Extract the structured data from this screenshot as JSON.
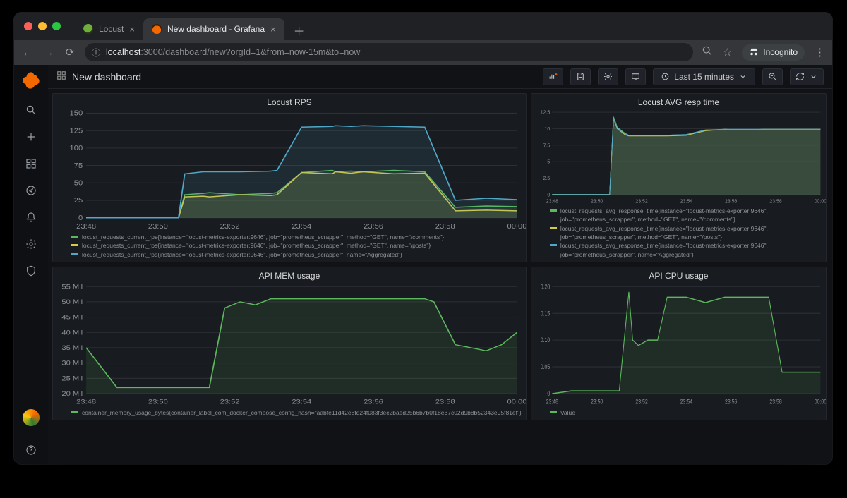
{
  "browser": {
    "tabs": [
      {
        "label": "Locust",
        "active": false
      },
      {
        "label": "New dashboard - Grafana",
        "active": true
      }
    ],
    "url_host": "localhost",
    "url_rest": ":3000/dashboard/new?orgId=1&from=now-15m&to=now",
    "incognito_label": "Incognito"
  },
  "grafana": {
    "title": "New dashboard",
    "toolbar": {
      "time_label": "Last 15 minutes"
    },
    "sidebar": {
      "items": [
        {
          "name": "search",
          "icon": "search"
        },
        {
          "name": "create",
          "icon": "plus"
        },
        {
          "name": "dashboards",
          "icon": "grid"
        },
        {
          "name": "explore",
          "icon": "compass"
        },
        {
          "name": "alerting",
          "icon": "bell"
        },
        {
          "name": "configuration",
          "icon": "gear"
        },
        {
          "name": "server-admin",
          "icon": "shield"
        }
      ]
    }
  },
  "chart_data": [
    {
      "id": "rps",
      "type": "area",
      "title": "Locust RPS",
      "xlabel": "",
      "ylabel": "",
      "x_ticks": [
        "23:48",
        "23:50",
        "23:52",
        "23:54",
        "23:56",
        "23:58",
        "00:00"
      ],
      "ylim": [
        0,
        150
      ],
      "y_ticks": [
        0,
        25,
        50,
        75,
        100,
        125,
        150
      ],
      "x": [
        0,
        1,
        2,
        3,
        3.2,
        3.8,
        4,
        5,
        6,
        6.2,
        7,
        8,
        8.1,
        8.6,
        9,
        10,
        11,
        12,
        13,
        14
      ],
      "series": [
        {
          "name": "locust_requests_current_rps{instance=\"locust-metrics-exporter:9646\", job=\"prometheus_scrapper\", method=\"GET\", name=\"/comments\"}",
          "color": "#5cb85c",
          "values": [
            0,
            0,
            0,
            0,
            33,
            35,
            36,
            33,
            35,
            36,
            65,
            68,
            66,
            67,
            66,
            68,
            66,
            15,
            17,
            16
          ]
        },
        {
          "name": "locust_requests_current_rps{instance=\"locust-metrics-exporter:9646\", job=\"prometheus_scrapper\", method=\"GET\", name=\"/posts\"}",
          "color": "#d4c94a",
          "values": [
            0,
            0,
            0,
            0,
            30,
            31,
            30,
            33,
            32,
            33,
            65,
            63,
            66,
            64,
            66,
            63,
            64,
            10,
            11,
            10
          ]
        },
        {
          "name": "locust_requests_current_rps{instance=\"locust-metrics-exporter:9646\", job=\"prometheus_scrapper\", name=\"Aggregated\"}",
          "color": "#4fa8c8",
          "values": [
            0,
            0,
            0,
            0,
            63,
            66,
            66,
            66,
            67,
            68,
            130,
            131,
            132,
            131,
            132,
            131,
            130,
            25,
            28,
            26
          ]
        }
      ]
    },
    {
      "id": "resp",
      "type": "area",
      "title": "Locust AVG resp time",
      "xlabel": "",
      "ylabel": "",
      "x_ticks": [
        "23:48",
        "23:50",
        "23:52",
        "23:54",
        "23:56",
        "23:58",
        "00:00"
      ],
      "ylim": [
        0,
        12.5
      ],
      "y_ticks": [
        0,
        2.5,
        5.0,
        7.5,
        10.0,
        12.5
      ],
      "x": [
        0,
        1,
        2,
        3,
        3.2,
        3.4,
        3.8,
        4,
        5,
        6,
        7,
        8,
        9,
        10,
        11,
        12,
        13,
        14
      ],
      "series": [
        {
          "name": "locust_requests_avg_response_time{instance=\"locust-metrics-exporter:9646\", job=\"prometheus_scrapper\", method=\"GET\", name=\"/comments\"}",
          "color": "#5cb85c",
          "values": [
            0,
            0,
            0,
            0,
            11.8,
            10.2,
            9.3,
            9.0,
            9.0,
            9.0,
            9.1,
            9.8,
            9.8,
            9.8,
            9.8,
            9.8,
            9.8,
            9.8
          ]
        },
        {
          "name": "locust_requests_avg_response_time{instance=\"locust-metrics-exporter:9646\", job=\"prometheus_scrapper\", method=\"GET\", name=\"/posts\"}",
          "color": "#d4c94a",
          "values": [
            0,
            0,
            0,
            0,
            11.5,
            10.0,
            9.1,
            8.9,
            8.9,
            8.9,
            9.0,
            9.7,
            9.9,
            9.8,
            9.9,
            9.9,
            9.9,
            9.9
          ]
        },
        {
          "name": "locust_requests_avg_response_time{instance=\"locust-metrics-exporter:9646\", job=\"prometheus_scrapper\", name=\"Aggregated\"}",
          "color": "#4fa8c8",
          "values": [
            0,
            0,
            0,
            0,
            11.6,
            10.1,
            9.2,
            9.0,
            9.0,
            9.0,
            9.1,
            9.8,
            9.9,
            9.9,
            9.9,
            9.9,
            9.9,
            9.9
          ]
        }
      ]
    },
    {
      "id": "mem",
      "type": "area",
      "title": "API MEM usage",
      "xlabel": "",
      "ylabel": "",
      "x_ticks": [
        "23:48",
        "23:50",
        "23:52",
        "23:54",
        "23:56",
        "23:58",
        "00:00"
      ],
      "ylim": [
        20,
        55
      ],
      "y_ticks": [
        20,
        25,
        30,
        35,
        40,
        45,
        50,
        55
      ],
      "y_tick_suffix": " Mil",
      "x": [
        0,
        1,
        1.5,
        2,
        3,
        4,
        4.5,
        5,
        5.5,
        6,
        6.5,
        7,
        8,
        9,
        10,
        11,
        11.3,
        12,
        12.5,
        13,
        13.5,
        14
      ],
      "series": [
        {
          "name": "container_memory_usage_bytes{container_label_com_docker_compose_config_hash=\"aabfe11d42e8fd24f083f3ec2baed25b6b7b0f18e37c02d9b8b52343e95f81ef\"}",
          "color": "#5cb85c",
          "values": [
            35,
            22,
            22,
            22,
            22,
            22,
            48,
            50,
            49,
            51,
            51,
            51,
            51,
            51,
            51,
            51,
            50,
            36,
            35,
            34,
            36,
            40
          ]
        }
      ]
    },
    {
      "id": "cpu",
      "type": "area",
      "title": "API CPU usage",
      "xlabel": "",
      "ylabel": "",
      "x_ticks": [
        "23:48",
        "23:50",
        "23:52",
        "23:54",
        "23:56",
        "23:58",
        "00:00"
      ],
      "ylim": [
        0,
        0.2
      ],
      "y_ticks": [
        0,
        0.05,
        0.1,
        0.15,
        0.2
      ],
      "x": [
        0,
        1,
        2,
        3,
        3.5,
        4,
        4.2,
        4.5,
        5,
        5.5,
        6,
        6.5,
        7,
        8,
        9,
        10,
        11,
        11.3,
        12,
        13,
        14
      ],
      "series": [
        {
          "name": "Value",
          "color": "#5cb85c",
          "values": [
            0,
            0.005,
            0.005,
            0.005,
            0.005,
            0.19,
            0.1,
            0.09,
            0.1,
            0.1,
            0.18,
            0.18,
            0.18,
            0.17,
            0.18,
            0.18,
            0.18,
            0.18,
            0.04,
            0.04,
            0.04
          ]
        }
      ]
    }
  ]
}
